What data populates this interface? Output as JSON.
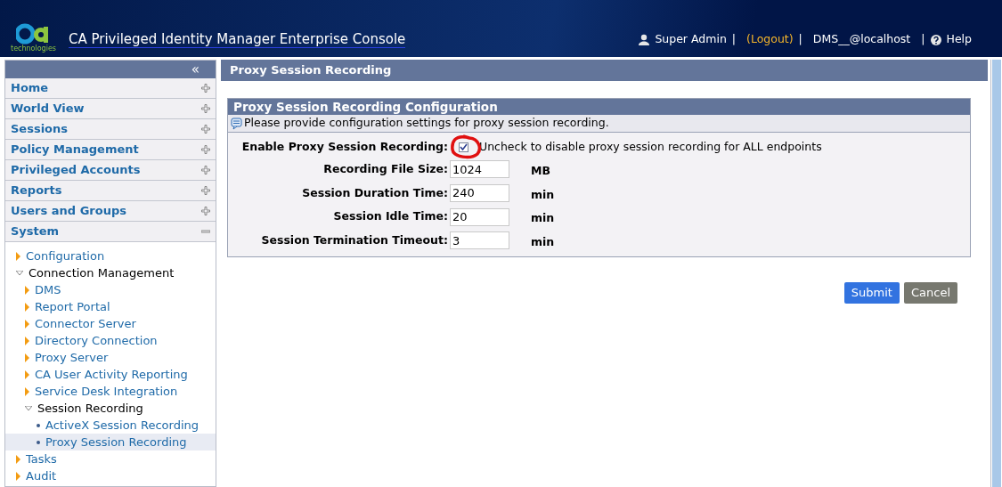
{
  "header": {
    "logo_word": "technologies",
    "title": "CA Privileged Identity Manager Enterprise Console",
    "user": "Super Admin",
    "separator": "|",
    "logout": "(Logout)",
    "host": "DMS__@localhost",
    "help": "Help"
  },
  "sidebar": {
    "collapse": "«",
    "sections": [
      {
        "label": "Home",
        "expanded": false
      },
      {
        "label": "World View",
        "expanded": false
      },
      {
        "label": "Sessions",
        "expanded": false
      },
      {
        "label": "Policy Management",
        "expanded": false
      },
      {
        "label": "Privileged Accounts",
        "expanded": false
      },
      {
        "label": "Reports",
        "expanded": false
      },
      {
        "label": "Users and Groups",
        "expanded": false
      },
      {
        "label": "System",
        "expanded": true,
        "children": [
          {
            "label": "Configuration",
            "expanded": false,
            "selected": false
          },
          {
            "label": "Connection Management",
            "expanded": true,
            "selected": false,
            "children": [
              {
                "label": "DMS",
                "expanded": false,
                "selected": false
              },
              {
                "label": "Report Portal",
                "expanded": false,
                "selected": false
              },
              {
                "label": "Connector Server",
                "expanded": false,
                "selected": false
              },
              {
                "label": "Directory Connection",
                "expanded": false,
                "selected": false
              },
              {
                "label": "Proxy Server",
                "expanded": false,
                "selected": false
              },
              {
                "label": "CA User Activity Reporting",
                "expanded": false,
                "selected": false
              },
              {
                "label": "Service Desk Integration",
                "expanded": false,
                "selected": false
              },
              {
                "label": "Session Recording",
                "expanded": true,
                "selected": false,
                "children": [
                  {
                    "label": "ActiveX Session Recording",
                    "kind": "leaf",
                    "selected": false
                  },
                  {
                    "label": "Proxy Session Recording",
                    "kind": "leaf",
                    "selected": true
                  }
                ]
              }
            ]
          },
          {
            "label": "Tasks",
            "expanded": false,
            "selected": false
          },
          {
            "label": "Audit",
            "expanded": false,
            "selected": false
          }
        ]
      }
    ]
  },
  "page_title": "Proxy Session Recording",
  "config": {
    "title": "Proxy Session Recording Configuration",
    "info": "Please provide configuration settings for proxy session recording.",
    "enable": {
      "label": "Enable Proxy Session Recording:",
      "checked": true,
      "hint": "Uncheck to disable proxy session recording for ALL endpoints"
    },
    "fields": [
      {
        "label": "Recording File Size:",
        "value": "1024",
        "unit": "MB"
      },
      {
        "label": "Session Duration Time:",
        "value": "240",
        "unit": "min"
      },
      {
        "label": "Session Idle Time:",
        "value": "20",
        "unit": "min"
      },
      {
        "label": "Session Termination Timeout:",
        "value": "3",
        "unit": "min"
      }
    ]
  },
  "buttons": [
    {
      "label": "Submit",
      "kind": "primary"
    },
    {
      "label": "Cancel",
      "kind": "secondary"
    }
  ]
}
